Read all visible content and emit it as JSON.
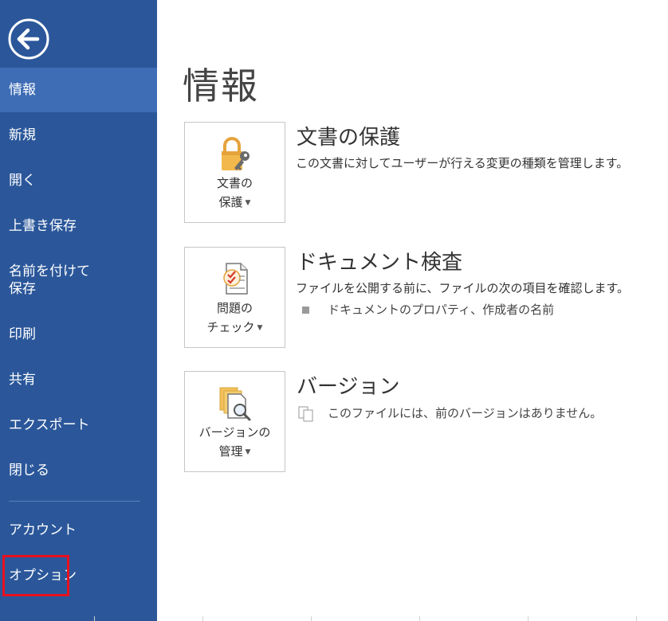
{
  "sidebar": {
    "back_label": "",
    "items": [
      {
        "label": "情報",
        "active": true
      },
      {
        "label": "新規"
      },
      {
        "label": "開く"
      },
      {
        "label": "上書き保存"
      },
      {
        "label": "名前を付けて\n保存"
      },
      {
        "label": "印刷"
      },
      {
        "label": "共有"
      },
      {
        "label": "エクスポート"
      },
      {
        "label": "閉じる"
      },
      {
        "label": "アカウント"
      },
      {
        "label": "オプション"
      }
    ]
  },
  "main": {
    "title": "情報",
    "sections": [
      {
        "tile_label": "文書の\n保護",
        "title": "文書の保護",
        "description": "この文書に対してユーザーが行える変更の種類を管理します。",
        "icon": "lock-key-icon"
      },
      {
        "tile_label": "問題の\nチェック",
        "title": "ドキュメント検査",
        "description": "ファイルを公開する前に、ファイルの次の項目を確認します。",
        "bullet": "ドキュメントのプロパティ、作成者の名前",
        "icon": "checklist-document-icon"
      },
      {
        "tile_label": "バージョンの\n管理",
        "title": "バージョン",
        "description": "このファイルには、前のバージョンはありません。",
        "icon": "document-search-icon"
      }
    ]
  },
  "colors": {
    "sidebar_bg": "#2b579a",
    "sidebar_active": "#3e6db5",
    "highlight_outline": "#e8111f"
  }
}
